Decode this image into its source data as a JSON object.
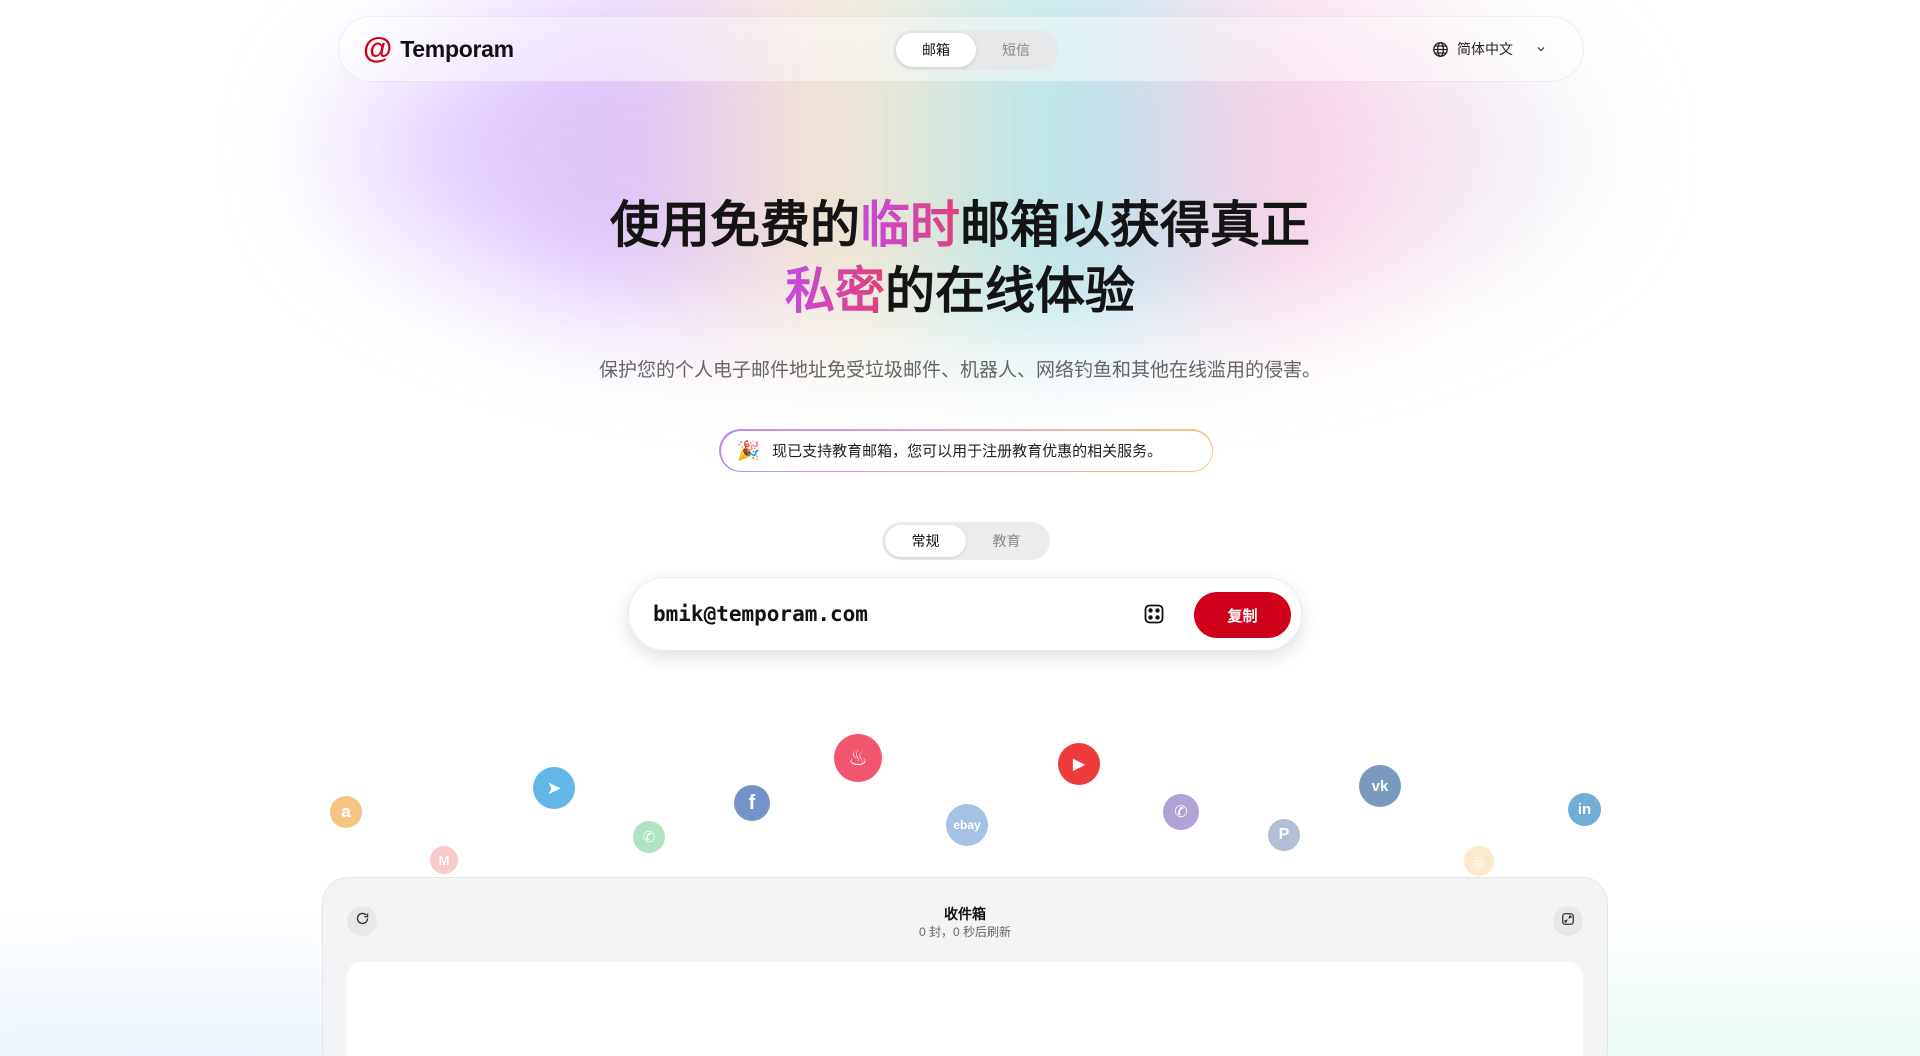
{
  "header": {
    "brand_icon": "@",
    "brand_name": "Temporam",
    "tabs": [
      {
        "label": "邮箱",
        "active": true
      },
      {
        "label": "短信",
        "active": false
      }
    ],
    "language": "简体中文"
  },
  "hero": {
    "title_line1_a": "使用免费的",
    "title_line1_highlight": "临时",
    "title_line1_b": "邮箱以获得真正",
    "title_line2_highlight": "私密",
    "title_line2_b": "的在线体验",
    "subtitle": "保护您的个人电子邮件地址免受垃圾邮件、机器人、网络钓鱼和其他在线滥用的侵害。"
  },
  "notice": {
    "emoji": "🎉",
    "text": "现已支持教育邮箱，您可以用于注册教育优惠的相关服务。"
  },
  "mode_tabs": [
    {
      "label": "常规",
      "active": true
    },
    {
      "label": "教育",
      "active": false
    }
  ],
  "email": {
    "address": "bmik@temporam.com",
    "copy_label": "复制"
  },
  "service_icons": [
    {
      "name": "amazon-icon",
      "glyph": "a",
      "color": "#f3b25b"
    },
    {
      "name": "gmail-icon",
      "glyph": "M",
      "color": "#f08a8a"
    },
    {
      "name": "telegram-icon",
      "glyph": "➤",
      "color": "#4fb0e6"
    },
    {
      "name": "whatsapp-icon",
      "glyph": "✆",
      "color": "#7bd39a"
    },
    {
      "name": "facebook-icon",
      "glyph": "f",
      "color": "#5b7fbf"
    },
    {
      "name": "tinder-icon",
      "glyph": "♨",
      "color": "#f2566f"
    },
    {
      "name": "ebay-icon",
      "glyph": "ebay",
      "color": "#8fb3e0"
    },
    {
      "name": "youtube-icon",
      "glyph": "▶",
      "color": "#ee3b3b"
    },
    {
      "name": "viber-icon",
      "glyph": "✆",
      "color": "#9d8ccc"
    },
    {
      "name": "paypal-icon",
      "glyph": "P",
      "color": "#a9b8cf"
    },
    {
      "name": "vk-icon",
      "glyph": "vk",
      "color": "#6b8fb8"
    },
    {
      "name": "instagram-icon",
      "glyph": "◎",
      "color": "#f7cf8f"
    },
    {
      "name": "linkedin-icon",
      "glyph": "in",
      "color": "#5a9fd0"
    }
  ],
  "inbox": {
    "title": "收件箱",
    "status": "0 封，0 秒后刷新"
  }
}
